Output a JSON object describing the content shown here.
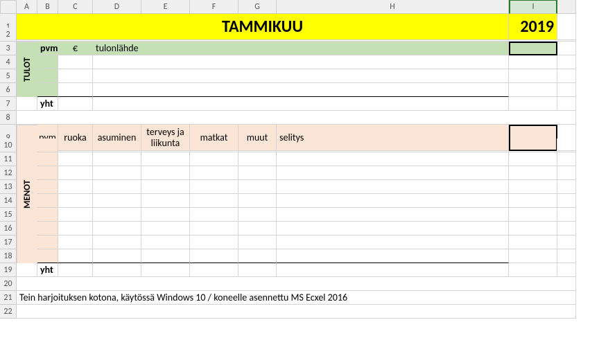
{
  "columns": [
    "A",
    "B",
    "C",
    "D",
    "E",
    "F",
    "G",
    "H",
    "I"
  ],
  "row_count": 22,
  "row1": {
    "title": "TAMMIKUU",
    "year": "2019"
  },
  "row3": {
    "pvm": "pvm",
    "euro": "€",
    "lahde": "tulonlähde"
  },
  "tulot_label": "TULOT",
  "row7": {
    "yht": "yht"
  },
  "row9": {
    "pvm": "pvm",
    "ruoka": "ruoka",
    "asuminen": "asuminen",
    "terveys": "terveys ja liikunta",
    "matkat": "matkat",
    "muut": "muut",
    "selitys": "selitys"
  },
  "menot_label": "MENOT",
  "row19": {
    "yht": "yht"
  },
  "row21": {
    "note": "Tein harjoituksen kotona, käytössä Windows 10 / koneelle asennettu MS Ecxel 2016"
  }
}
